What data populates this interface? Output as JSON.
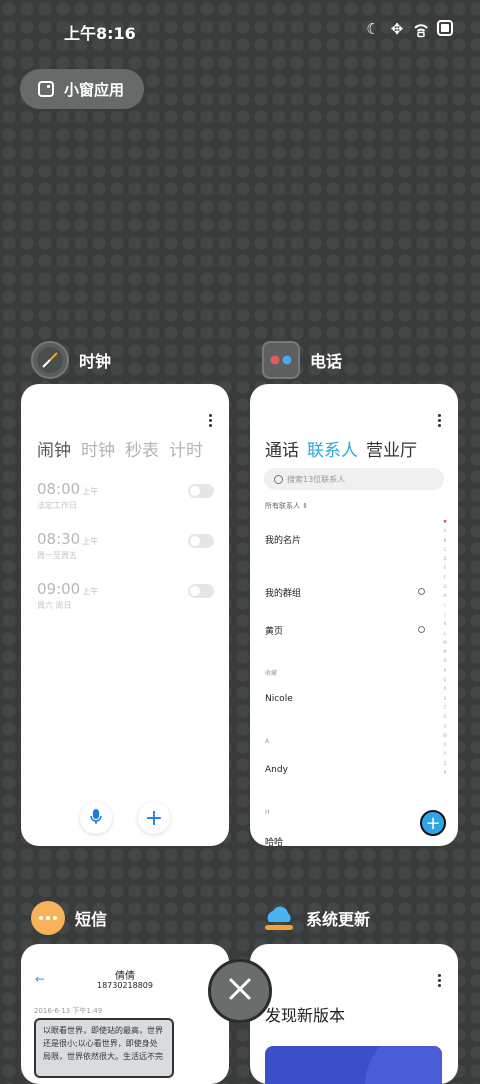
{
  "status": {
    "time": "上午8:16"
  },
  "float_window": {
    "label": "小窗应用"
  },
  "clock": {
    "name": "时钟",
    "tabs": [
      "闹钟",
      "时钟",
      "秒表",
      "计时"
    ],
    "alarms": [
      {
        "time": "08:00",
        "ampm": "上午",
        "repeat": "法定工作日",
        "enabled": false
      },
      {
        "time": "08:30",
        "ampm": "上午",
        "repeat": "周一至周五",
        "enabled": false
      },
      {
        "time": "09:00",
        "ampm": "上午",
        "repeat": "周六 周日",
        "enabled": false
      }
    ]
  },
  "phone": {
    "name": "电话",
    "tabs": [
      "通话",
      "联系人",
      "营业厅"
    ],
    "search_placeholder": "搜索13位联系人",
    "filter": "所有联系人",
    "my_card": "我的名片",
    "my_groups": "我的群组",
    "yellow_pages": "黄页",
    "favorites_header": "收藏",
    "contacts": [
      {
        "section": "",
        "name": "Nicole"
      },
      {
        "section": "A",
        "name": "Andy"
      },
      {
        "section": "H",
        "name": "哈哈"
      }
    ],
    "index": [
      "A",
      "B",
      "C",
      "D",
      "E",
      "F",
      "G",
      "H",
      "I",
      "J",
      "K",
      "L",
      "M",
      "N",
      "O",
      "P",
      "Q",
      "R",
      "S",
      "T",
      "U",
      "V",
      "W",
      "X",
      "Y",
      "Z",
      "#"
    ]
  },
  "sms": {
    "name": "短信",
    "contact": "倩倩",
    "number": "18730218809",
    "date": "2016-6-13 下午1:49",
    "message": "以眼看世界，即使站的最高，世界还是很小;以心看世界，即使身处局限，世界依然很大。生活远不完"
  },
  "update": {
    "name": "系统更新",
    "title": "发现新版本"
  },
  "colors": {
    "accent": "#29a9dd",
    "clock_blue": "#1e7be0",
    "sms_orange": "#f8b35a"
  }
}
